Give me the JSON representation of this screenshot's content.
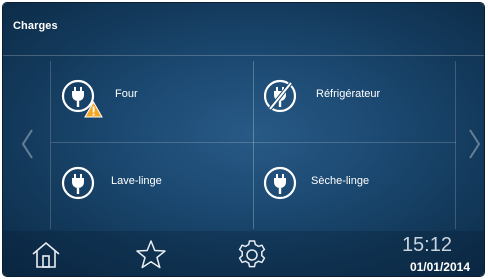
{
  "header": {
    "title": "Charges"
  },
  "loads": [
    {
      "label": "Four",
      "icon": "plug-icon",
      "status": "warning"
    },
    {
      "label": "Réfrigérateur",
      "icon": "plug-off-icon",
      "status": "off"
    },
    {
      "label": "Lave-linge",
      "icon": "plug-icon",
      "status": "normal"
    },
    {
      "label": "Sèche-linge",
      "icon": "plug-icon",
      "status": "normal"
    }
  ],
  "navigation": {
    "prev": "chevron-left-icon",
    "next": "chevron-right-icon"
  },
  "bottom_bar": {
    "items": [
      "home-icon",
      "star-icon",
      "gear-icon"
    ],
    "time": "15:12",
    "date": "01/01/2014"
  },
  "colors": {
    "background": "#1c4a73",
    "warning": "#f5a623",
    "text": "#ffffff"
  }
}
